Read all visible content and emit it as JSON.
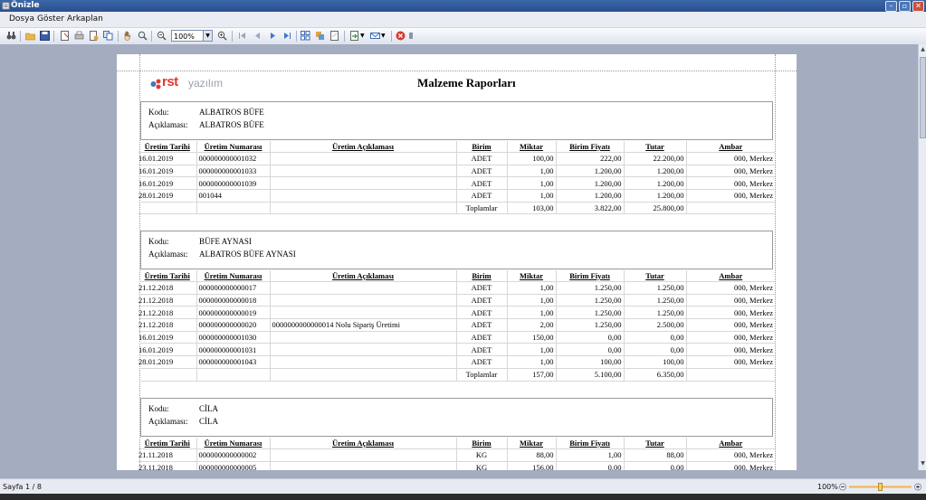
{
  "window": {
    "title": "Önizle"
  },
  "menu": {
    "file": "Dosya",
    "view": "Göster",
    "background": "Arkaplan"
  },
  "toolbar": {
    "zoom_value": "100%"
  },
  "report": {
    "brand_rst": "rst",
    "brand_rest": "yazılım",
    "title": "Malzeme Raporları",
    "labels": {
      "code": "Kodu:",
      "desc": "Açıklaması:"
    },
    "headers": {
      "date": "Üretim Tarihi",
      "number": "Üretim Numarası",
      "description": "Üretim Açıklaması",
      "unit": "Birim",
      "qty": "Miktar",
      "price": "Birim Fiyatı",
      "amount": "Tutar",
      "warehouse": "Ambar"
    },
    "groups": [
      {
        "code": "ALBATROS BÜFE",
        "desc": "ALBATROS BÜFE",
        "rows": [
          {
            "date": "16.01.2019",
            "number": "000000000001032",
            "description": "",
            "unit": "ADET",
            "qty": "100,00",
            "price": "222,00",
            "amount": "22.200,00",
            "warehouse": "000, Merkez"
          },
          {
            "date": "16.01.2019",
            "number": "000000000001033",
            "description": "",
            "unit": "ADET",
            "qty": "1,00",
            "price": "1.200,00",
            "amount": "1.200,00",
            "warehouse": "000, Merkez"
          },
          {
            "date": "16.01.2019",
            "number": "000000000001039",
            "description": "",
            "unit": "ADET",
            "qty": "1,00",
            "price": "1.200,00",
            "amount": "1.200,00",
            "warehouse": "000, Merkez"
          },
          {
            "date": "28.01.2019",
            "number": "001044",
            "description": "",
            "unit": "ADET",
            "qty": "1,00",
            "price": "1.200,00",
            "amount": "1.200,00",
            "warehouse": "000, Merkez"
          }
        ],
        "totals": {
          "label": "Toplamlar",
          "qty": "103,00",
          "price": "3.822,00",
          "amount": "25.800,00"
        }
      },
      {
        "code": "BÜFE AYNASI",
        "desc": "ALBATROS BÜFE AYNASI",
        "rows": [
          {
            "date": "21.12.2018",
            "number": "000000000000017",
            "description": "",
            "unit": "ADET",
            "qty": "1,00",
            "price": "1.250,00",
            "amount": "1.250,00",
            "warehouse": "000, Merkez"
          },
          {
            "date": "21.12.2018",
            "number": "000000000000018",
            "description": "",
            "unit": "ADET",
            "qty": "1,00",
            "price": "1.250,00",
            "amount": "1.250,00",
            "warehouse": "000, Merkez"
          },
          {
            "date": "21.12.2018",
            "number": "000000000000019",
            "description": "",
            "unit": "ADET",
            "qty": "1,00",
            "price": "1.250,00",
            "amount": "1.250,00",
            "warehouse": "000, Merkez"
          },
          {
            "date": "21.12.2018",
            "number": "000000000000020",
            "description": "0000000000000014 Nolu Sipariş Üretimi",
            "unit": "ADET",
            "qty": "2,00",
            "price": "1.250,00",
            "amount": "2.500,00",
            "warehouse": "000, Merkez"
          },
          {
            "date": "16.01.2019",
            "number": "000000000001030",
            "description": "",
            "unit": "ADET",
            "qty": "150,00",
            "price": "0,00",
            "amount": "0,00",
            "warehouse": "000, Merkez"
          },
          {
            "date": "16.01.2019",
            "number": "000000000001031",
            "description": "",
            "unit": "ADET",
            "qty": "1,00",
            "price": "0,00",
            "amount": "0,00",
            "warehouse": "000, Merkez"
          },
          {
            "date": "28.01.2019",
            "number": "000000000001043",
            "description": "",
            "unit": "ADET",
            "qty": "1,00",
            "price": "100,00",
            "amount": "100,00",
            "warehouse": "000, Merkez"
          }
        ],
        "totals": {
          "label": "Toplamlar",
          "qty": "157,00",
          "price": "5.100,00",
          "amount": "6.350,00"
        }
      },
      {
        "code": "CİLA",
        "desc": "CİLA",
        "rows": [
          {
            "date": "21.11.2018",
            "number": "000000000000002",
            "description": "",
            "unit": "KG",
            "qty": "88,00",
            "price": "1,00",
            "amount": "88,00",
            "warehouse": "000, Merkez"
          },
          {
            "date": "23.11.2018",
            "number": "000000000000005",
            "description": "",
            "unit": "KG",
            "qty": "156,00",
            "price": "0,00",
            "amount": "0,00",
            "warehouse": "000, Merkez"
          }
        ]
      }
    ]
  },
  "status": {
    "page": "Sayfa 1 / 8",
    "zoom": "100%",
    "zoom_level": 0.5
  }
}
